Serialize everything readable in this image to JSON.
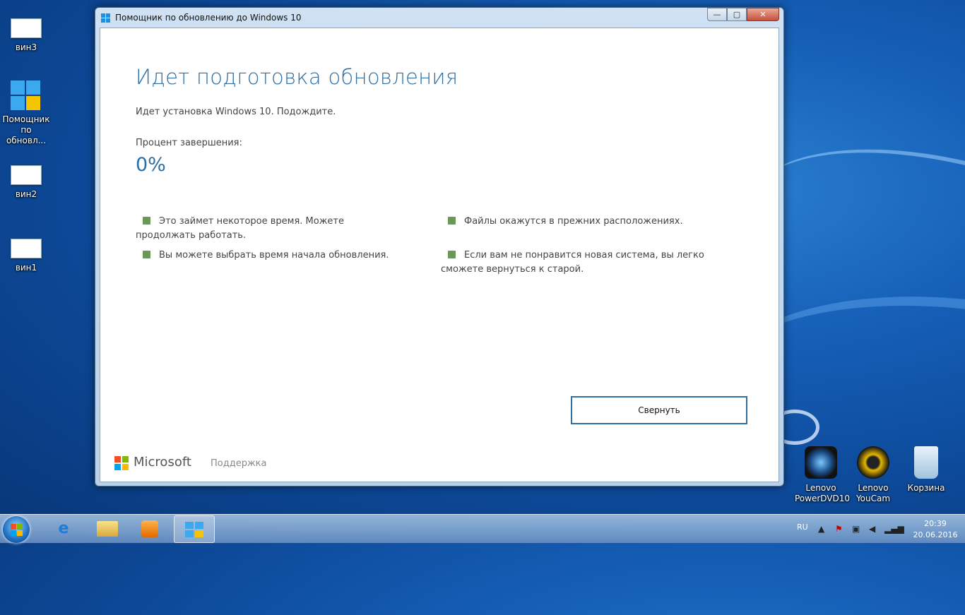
{
  "desktop": {
    "icons_left": [
      {
        "label": "вин3"
      },
      {
        "label": "Помощник по обновл..."
      },
      {
        "label": "вин2"
      },
      {
        "label": "вин1"
      }
    ],
    "icons_right": [
      {
        "label": "Lenovo PowerDVD10"
      },
      {
        "label": "Lenovo YouCam"
      },
      {
        "label": "Корзина"
      }
    ]
  },
  "window": {
    "title": "Помощник по обновлению до Windows 10",
    "controls": {
      "minimize": "—",
      "maximize": "▢",
      "close": "✕"
    },
    "heading": "Идет подготовка обновления",
    "subtitle": "Идет установка Windows 10. Подождите.",
    "percent_label": "Процент завершения:",
    "percent_value": "0%",
    "bullets": [
      {
        "text": "Это займет некоторое время. Можете продолжать работать."
      },
      {
        "text": "Вы можете выбрать время начала обновления."
      },
      {
        "text": "Файлы окажутся в прежних расположениях."
      },
      {
        "text": "Если вам не понравится новая система, вы легко сможете вернуться к старой."
      }
    ],
    "minimize_button_label": "Свернуть",
    "brand": "Microsoft",
    "support_link": "Поддержка",
    "colors": {
      "accent": "#2d6ea3",
      "bullet": "#6a9a5b"
    }
  },
  "taskbar": {
    "language": "RU",
    "time": "20:39",
    "date": "20.06.2016"
  }
}
